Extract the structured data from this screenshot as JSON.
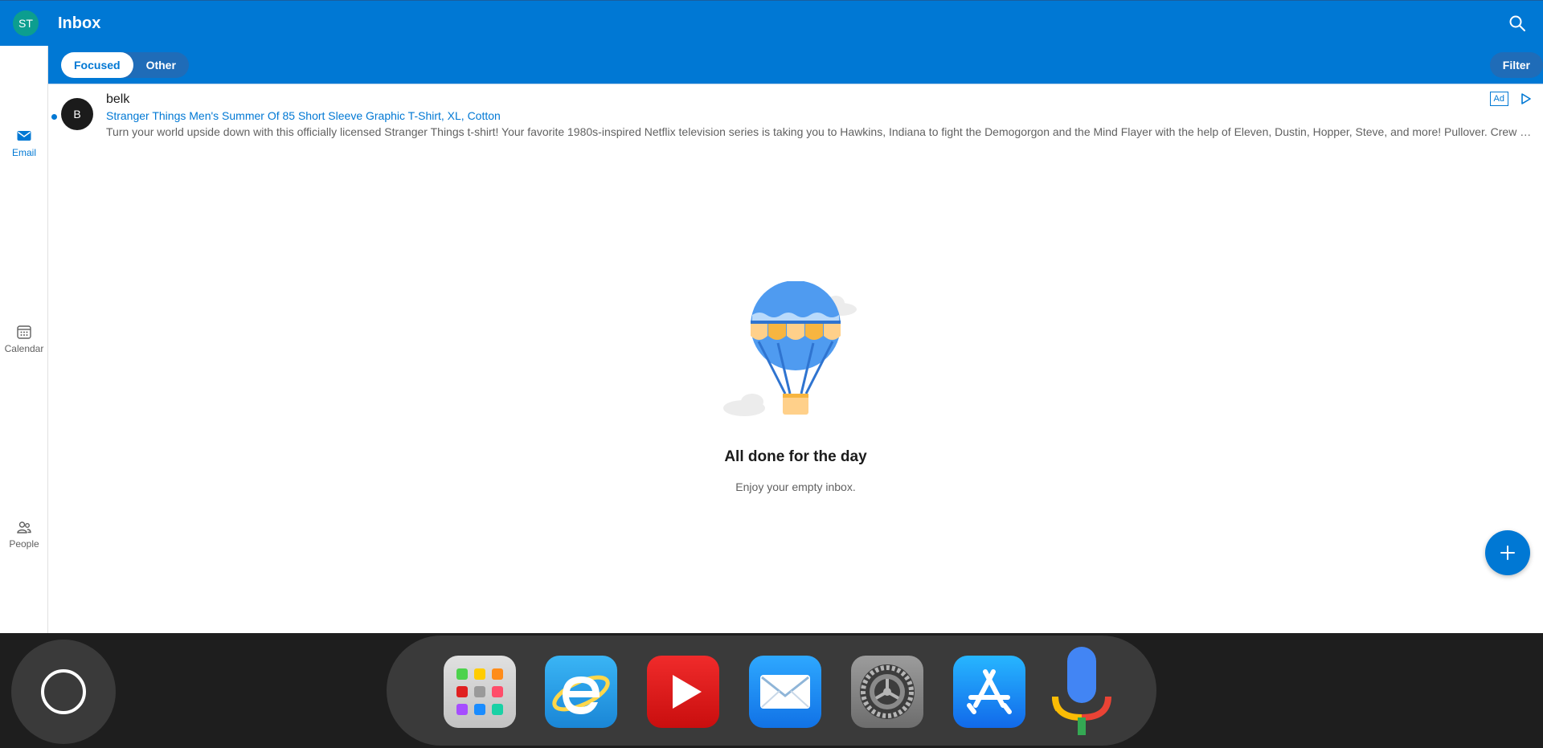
{
  "header": {
    "title": "Inbox",
    "user_initials": "ST"
  },
  "tabs": [
    {
      "label": "Focused",
      "active": true
    },
    {
      "label": "Other",
      "active": false
    }
  ],
  "filter_label": "Filter",
  "rail": {
    "email_label": "Email",
    "calendar_label": "Calendar",
    "people_label": "People"
  },
  "message": {
    "avatar_initial": "B",
    "sender": "belk",
    "subject": "Stranger Things Men's Summer Of 85 Short Sleeve Graphic T-Shirt, XL, Cotton",
    "preview": "Turn your world upside down with this officially licensed Stranger Things t-shirt! Your favorite 1980s-inspired Netflix television series is taking you to Hawkins, Indiana to fight the Demogorgon and the Mind Flayer with the help of Eleven, Dustin, Hopper, Steve, and more! Pullover. Crew ne...",
    "ad_label": "Ad",
    "unread": true
  },
  "empty_state": {
    "title": "All done for the day",
    "subtitle": "Enjoy your empty inbox."
  },
  "dock": {
    "apps": [
      "launchpad-icon",
      "internet-explorer-icon",
      "youtube-icon",
      "mail-icon",
      "settings-icon",
      "app-store-icon",
      "voice-assistant-icon"
    ]
  },
  "colors": {
    "accent": "#0078d4",
    "avatar_me": "#0c9e8f",
    "dock_bg": "#1e1e1e"
  }
}
